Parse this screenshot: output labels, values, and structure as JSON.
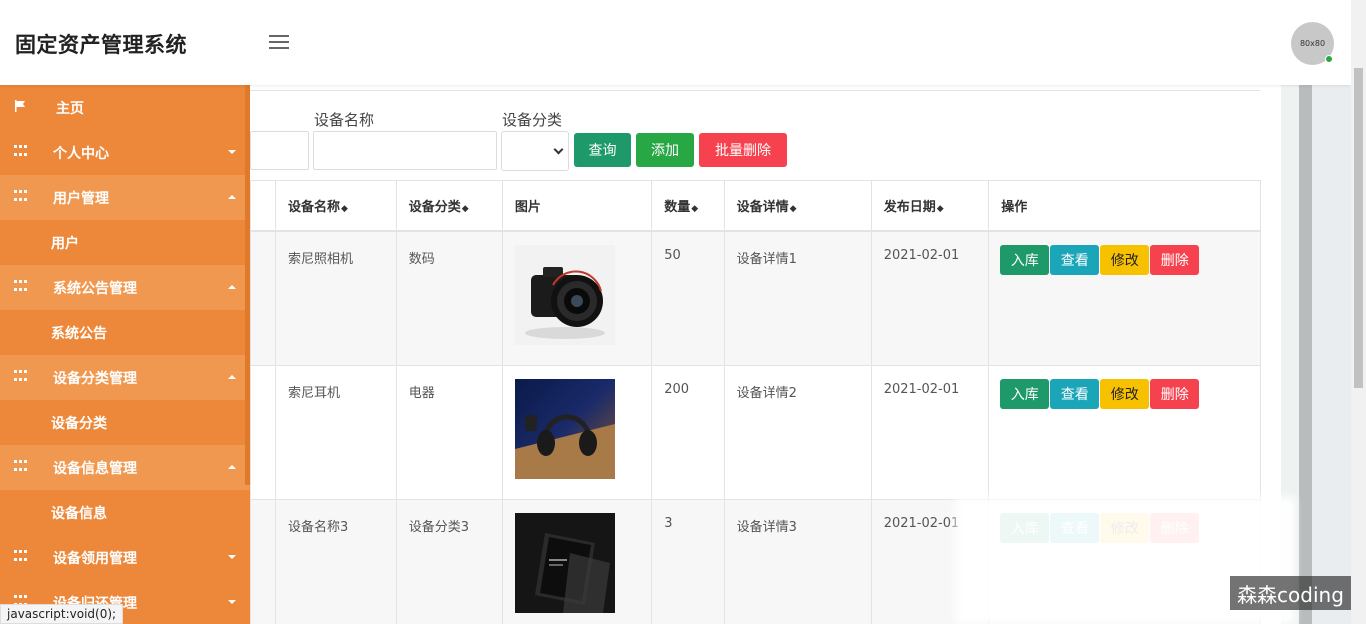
{
  "header": {
    "app_title": "固定资产管理系统",
    "avatar_text": "80x80"
  },
  "sidebar": {
    "items": [
      {
        "label": "主页",
        "icon": "flag-icon"
      },
      {
        "label": "个人中心",
        "icon": "grid-icon",
        "state": "collapsed"
      },
      {
        "label": "用户管理",
        "icon": "grid-icon",
        "state": "expanded",
        "children": [
          "用户"
        ]
      },
      {
        "label": "系统公告管理",
        "icon": "grid-icon",
        "state": "expanded",
        "children": [
          "系统公告"
        ]
      },
      {
        "label": "设备分类管理",
        "icon": "grid-icon",
        "state": "expanded",
        "children": [
          "设备分类"
        ]
      },
      {
        "label": "设备信息管理",
        "icon": "grid-icon",
        "state": "expanded",
        "children": [
          "设备信息"
        ]
      },
      {
        "label": "设备领用管理",
        "icon": "grid-icon",
        "state": "collapsed"
      },
      {
        "label": "设备归还管理",
        "icon": "grid-icon",
        "state": "collapsed"
      }
    ],
    "sub": {
      "users": "用户",
      "notices": "系统公告",
      "categories": "设备分类",
      "devices": "设备信息"
    }
  },
  "search": {
    "name_label": "设备名称",
    "name_value": "",
    "category_label": "设备分类",
    "category_value": "",
    "query_button": "查询",
    "add_button": "添加",
    "batch_delete_button": "批量删除"
  },
  "table": {
    "headers": {
      "name": "设备名称",
      "category": "设备分类",
      "image": "图片",
      "quantity": "数量",
      "detail": "设备详情",
      "date": "发布日期",
      "actions": "操作"
    },
    "sort_glyph": "◆",
    "rows": [
      {
        "name": "索尼照相机",
        "category": "数码",
        "image": "camera-image",
        "quantity": "50",
        "detail": "设备详情1",
        "date": "2021-02-01"
      },
      {
        "name": "索尼耳机",
        "category": "电器",
        "image": "headphones-image",
        "quantity": "200",
        "detail": "设备详情2",
        "date": "2021-02-01"
      },
      {
        "name": "设备名称3",
        "category": "设备分类3",
        "image": "phone-image",
        "quantity": "3",
        "detail": "设备详情3",
        "date": "2021-02-01"
      }
    ],
    "row_actions": {
      "stock_in": "入库",
      "view": "查看",
      "edit": "修改",
      "delete": "删除"
    }
  },
  "status_bar": {
    "link": "javascript:void(0);"
  },
  "watermark": "森森coding",
  "colors": {
    "sidebar": "#ed873a",
    "sidebar_open": "#f0984f",
    "query": "#1e9a6a",
    "add": "#28a745",
    "danger": "#f6424f",
    "info": "#1aa5b8",
    "warning": "#f8c100"
  }
}
